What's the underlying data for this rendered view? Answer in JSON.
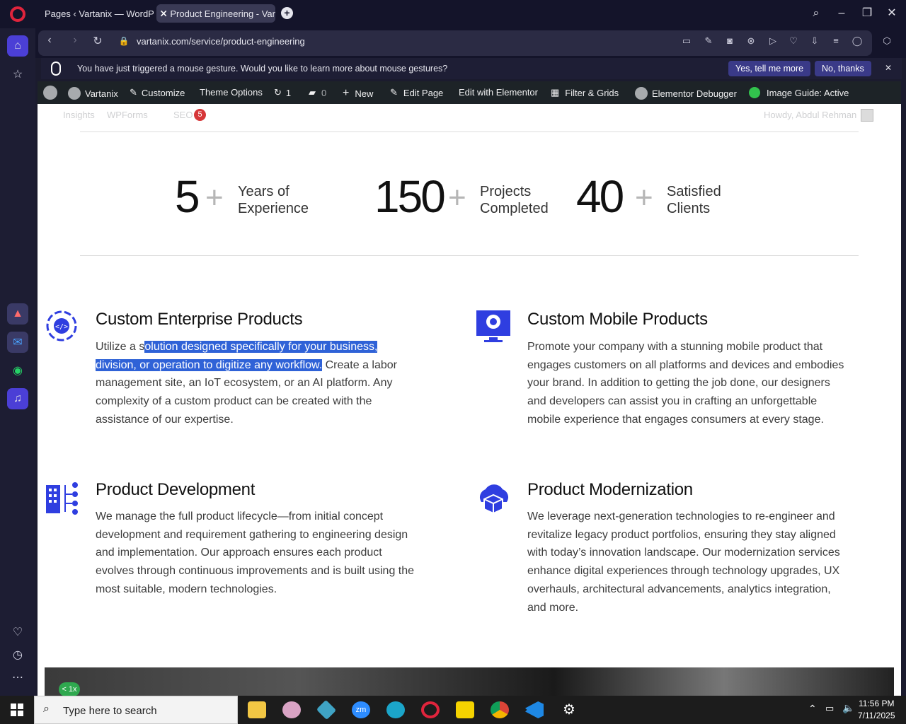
{
  "browser": {
    "tabs": [
      {
        "label": "Pages ‹ Vartanix — WordP"
      },
      {
        "label": "Product Engineering - Var"
      }
    ],
    "url": "vartanix.com/service/product-engineering"
  },
  "gesture_notice": {
    "message": "You have just triggered a mouse gesture. Would you like to learn more about mouse gestures?",
    "yes_label": "Yes, tell me more",
    "no_label": "No, thanks"
  },
  "wp_admin_bar": {
    "site": "Vartanix",
    "customize": "Customize",
    "theme_options": "Theme Options",
    "updates_count": "1",
    "comments_count": "0",
    "new": "New",
    "edit_page": "Edit Page",
    "edit_elementor": "Edit with Elementor",
    "filter_grids": "Filter & Grids",
    "elementor_debugger": "Elementor Debugger",
    "image_guide": "Image Guide: Active",
    "insights": "Insights",
    "wpforms": "WPForms",
    "seo": "SEO",
    "seo_count": "5",
    "howdy": "Howdy, Abdul Rehman"
  },
  "stats": [
    {
      "number": "5",
      "plus": "+",
      "label_line1": "Years of",
      "label_line2": "Experience"
    },
    {
      "number": "150",
      "plus": "+",
      "label_line1": "Projects",
      "label_line2": "Completed"
    },
    {
      "number": "40",
      "plus": "+",
      "label_line1": "Satisfied",
      "label_line2": "Clients"
    }
  ],
  "services": [
    {
      "title": "Custom Enterprise Products",
      "text_pre": "Utilize a s",
      "text_highlight": "olution designed specifically for your business, division, or operation to digitize any workflow.",
      "text_post": " Create a labor management site, an IoT ecosystem, or an AI platform. Any complexity of a custom product can be created with the assistance of our expertise.",
      "icon": "gear-code-icon"
    },
    {
      "title": "Custom Mobile Products",
      "text": "Promote your company with a stunning mobile product that engages customers on all platforms and devices and embodies your brand. In addition to getting the job done, our designers and developers can assist you in crafting an unforgettable mobile experience that engages consumers at every stage.",
      "icon": "monitor-search-icon"
    },
    {
      "title": "Product Development",
      "text": "We manage the full product lifecycle—from initial concept development and requirement gathering to engineering design and implementation. Our approach ensures each product evolves through continuous improvements and is built using the most suitable, modern technologies.",
      "icon": "building-checklist-icon"
    },
    {
      "title": "Product Modernization",
      "text": "We leverage next-generation technologies to re-engineer and revitalize legacy product portfolios, ensuring they stay aligned with today’s innovation landscape. Our modernization services enhance digital experiences through technology upgrades, UX overhauls, architectural advancements, analytics integration, and more.",
      "icon": "cloud-box-icon"
    }
  ],
  "video_badge": "< 1x",
  "taskbar": {
    "search_placeholder": "Type here to search",
    "time": "11:56 PM",
    "date": "7/11/2025"
  },
  "colors": {
    "accent_blue": "#2f3ee0",
    "highlight": "#2f62d7",
    "seo_badge": "#d63638"
  }
}
